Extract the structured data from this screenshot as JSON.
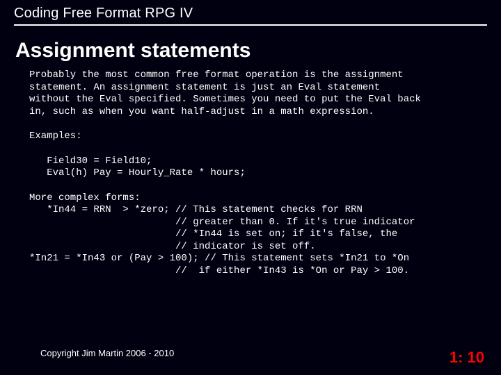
{
  "header": {
    "title": "Coding Free Format RPG IV"
  },
  "subtitle": "Assignment statements",
  "body": {
    "intro": "Probably the most common free format operation is the assignment\nstatement. An assignment statement is just an Eval statement\nwithout the Eval specified. Sometimes you need to put the Eval back\nin, such as when you want half-adjust in a math expression.",
    "examples_label": "Examples:",
    "examples_code": "   Field30 = Field10;\n   Eval(h) Pay = Hourly_Rate * hours;",
    "complex": "More complex forms:\n   *In44 = RRN  > *zero; // This statement checks for RRN\n                         // greater than 0. If it's true indicator\n                         // *In44 is set on; if it's false, the\n                         // indicator is set off.\n*In21 = *In43 or (Pay > 100); // This statement sets *In21 to *On\n                         //  if either *In43 is *On or Pay > 100."
  },
  "footer": {
    "copyright": "Copyright Jim Martin 2006 - 2010",
    "pagenum": "1: 10"
  }
}
